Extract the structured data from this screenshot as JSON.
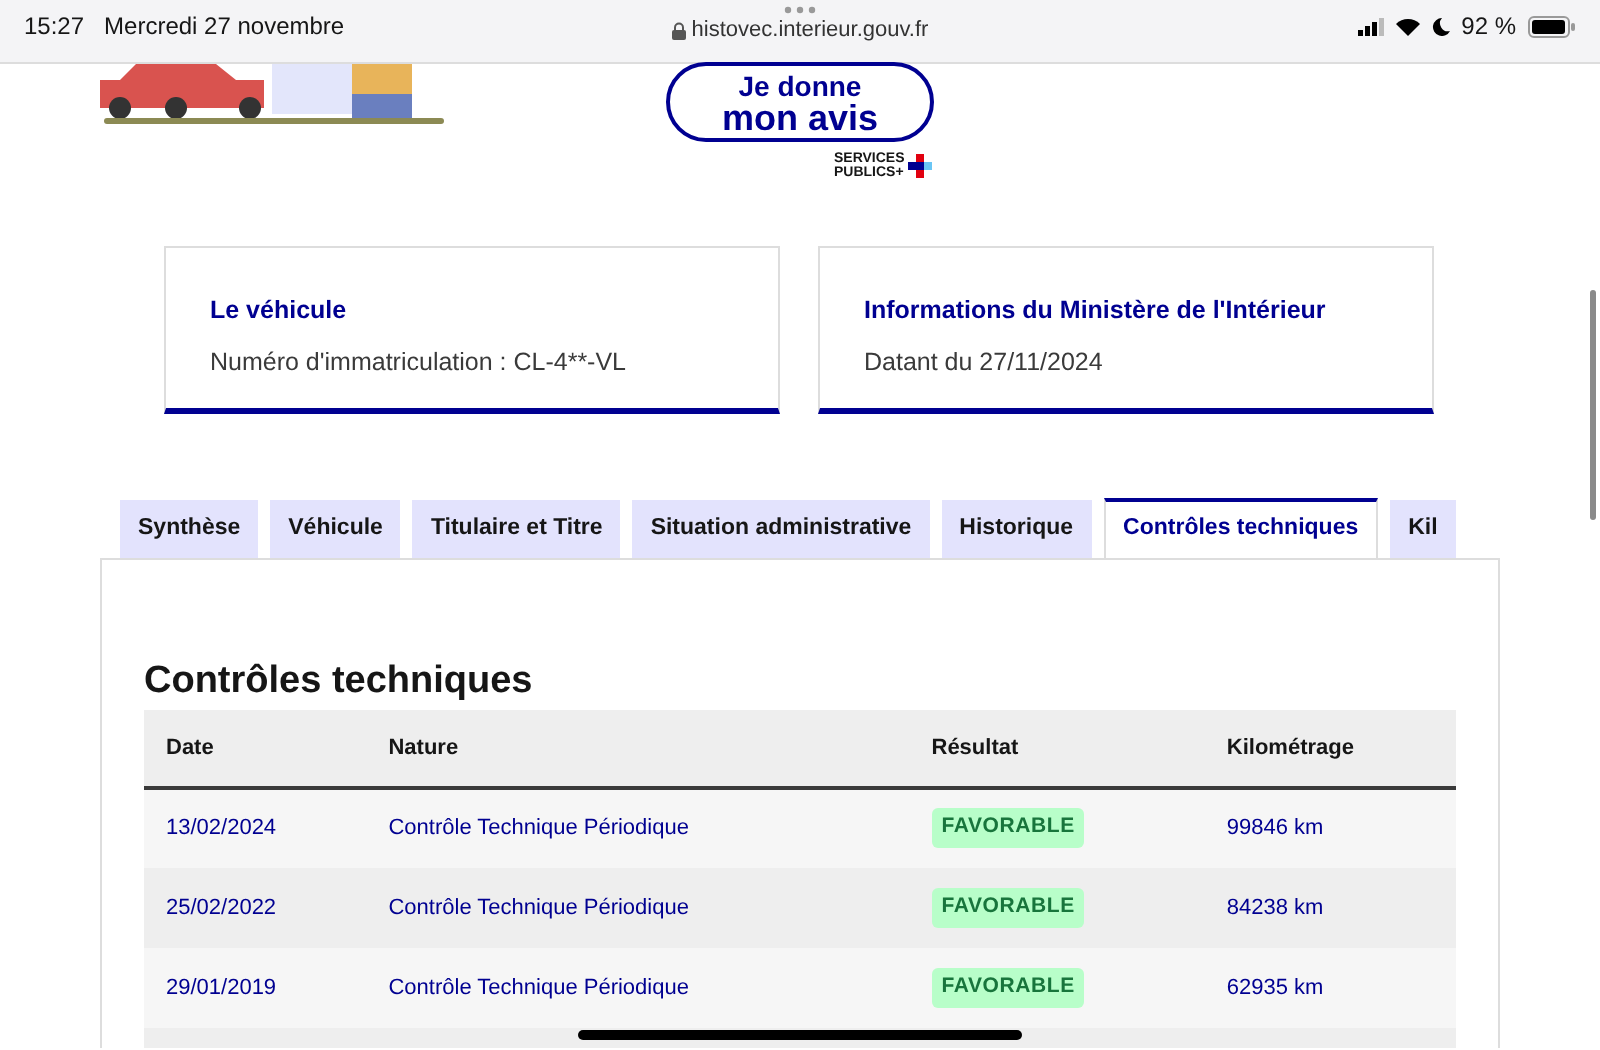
{
  "status_bar": {
    "time": "15:27",
    "date": "Mercredi 27 novembre",
    "battery": "92 %"
  },
  "address_bar": {
    "url": "histovec.interieur.gouv.fr"
  },
  "feedback_button": {
    "line_1": "Je donne",
    "line_2": "mon avis",
    "logo_line_1": "SERVICES",
    "logo_line_2": "PUBLICS+"
  },
  "info_cards": [
    {
      "title": "Le véhicule",
      "text": "Numéro d'immatriculation : CL-4**-VL"
    },
    {
      "title": "Informations du Ministère de l'Intérieur",
      "text": "Datant du 27/11/2024"
    }
  ],
  "tabs": [
    {
      "label": "Synthèse",
      "selected": false
    },
    {
      "label": "Véhicule",
      "selected": false
    },
    {
      "label": "Titulaire et Titre",
      "selected": false
    },
    {
      "label": "Situation administrative",
      "selected": false
    },
    {
      "label": "Historique",
      "selected": false
    },
    {
      "label": "Contrôles techniques",
      "selected": true
    },
    {
      "label": "Kil",
      "selected": false
    }
  ],
  "section": {
    "heading": "Contrôles techniques"
  },
  "table": {
    "columns": [
      "Date",
      "Nature",
      "Résultat",
      "Kilométrage"
    ],
    "rows": [
      {
        "date": "13/02/2024",
        "nature": "Contrôle Technique Périodique",
        "result": "FAVORABLE",
        "mileage": "99846 km"
      },
      {
        "date": "25/02/2022",
        "nature": "Contrôle Technique Périodique",
        "result": "FAVORABLE",
        "mileage": "84238 km"
      },
      {
        "date": "29/01/2019",
        "nature": "Contrôle Technique Périodique",
        "result": "FAVORABLE",
        "mileage": "62935 km"
      }
    ]
  }
}
